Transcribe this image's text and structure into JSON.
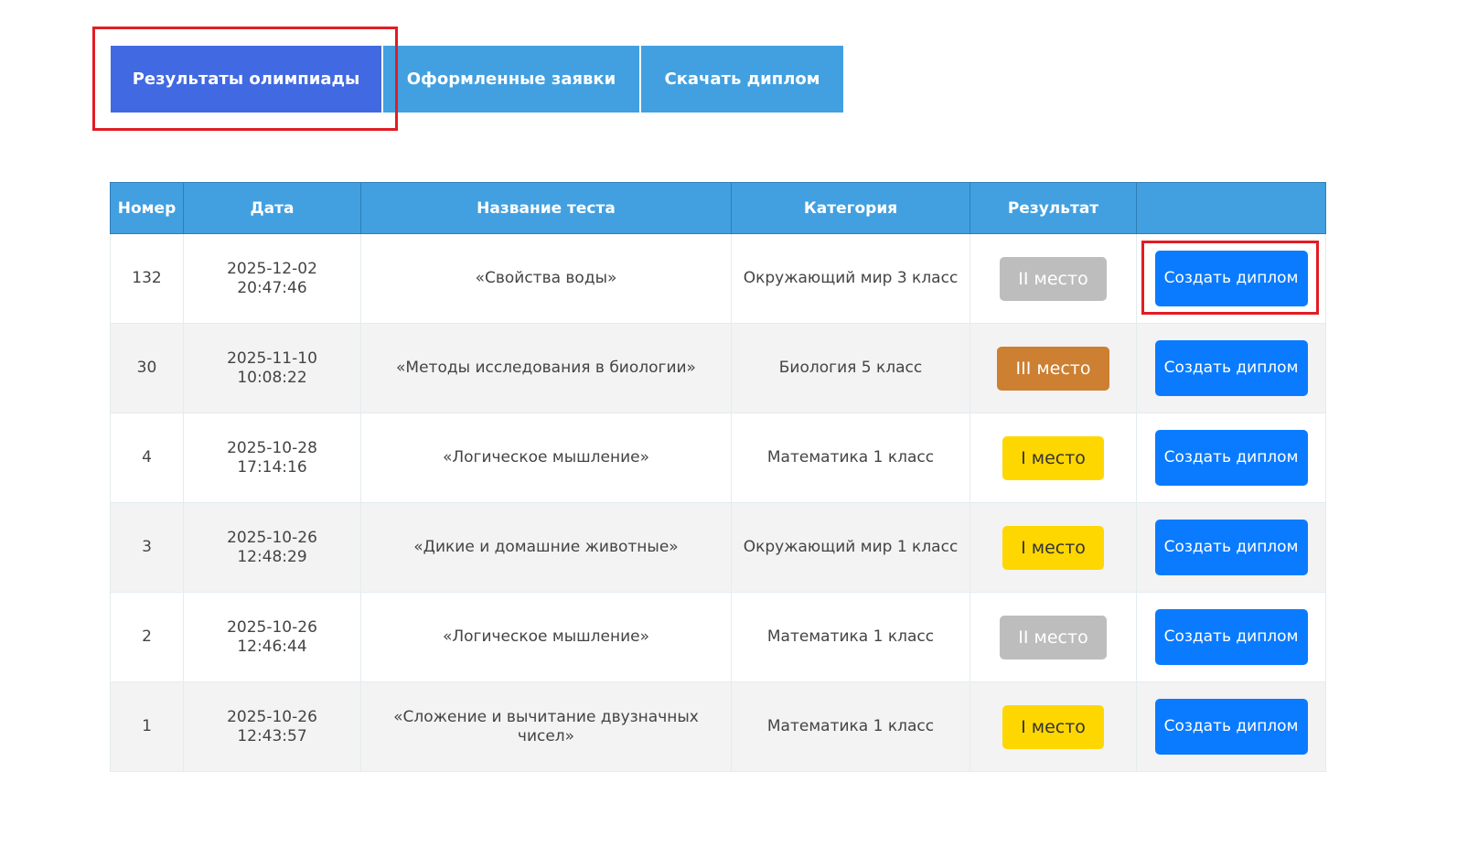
{
  "tabs": [
    {
      "label": "Результаты олимпиады",
      "active": true
    },
    {
      "label": "Оформленные заявки",
      "active": false
    },
    {
      "label": "Скачать диплом",
      "active": false
    }
  ],
  "colors": {
    "active_tab": "#4169e1",
    "tab": "#42a0e0",
    "header": "#42a0e0",
    "button": "#0a7bff",
    "highlight": "#e21c23",
    "place1": "#ffd700",
    "place2": "#bdbdbd",
    "place3": "#cd7f32"
  },
  "table": {
    "headers": [
      "Номер",
      "Дата",
      "Название теста",
      "Категория",
      "Результат",
      ""
    ],
    "rows": [
      {
        "num": "132",
        "date": "2025-12-02 20:47:46",
        "test": "«Свойства воды»",
        "category": "Окружающий мир 3 класс",
        "result": "II место",
        "place": 2,
        "button": "Создать диплом"
      },
      {
        "num": "30",
        "date": "2025-11-10 10:08:22",
        "test": "«Методы исследования в биологии»",
        "category": "Биология 5 класс",
        "result": "III место",
        "place": 3,
        "button": "Создать диплом"
      },
      {
        "num": "4",
        "date": "2025-10-28 17:14:16",
        "test": "«Логическое мышление»",
        "category": "Математика 1 класс",
        "result": "I место",
        "place": 1,
        "button": "Создать диплом"
      },
      {
        "num": "3",
        "date": "2025-10-26 12:48:29",
        "test": "«Дикие и домашние животные»",
        "category": "Окружающий мир 1 класс",
        "result": "I место",
        "place": 1,
        "button": "Создать диплом"
      },
      {
        "num": "2",
        "date": "2025-10-26 12:46:44",
        "test": "«Логическое мышление»",
        "category": "Математика 1 класс",
        "result": "II место",
        "place": 2,
        "button": "Создать диплом"
      },
      {
        "num": "1",
        "date": "2025-10-26 12:43:57",
        "test": "«Сложение и вычитание двузначных чисел»",
        "category": "Математика 1 класс",
        "result": "I место",
        "place": 1,
        "button": "Создать диплом"
      }
    ]
  }
}
